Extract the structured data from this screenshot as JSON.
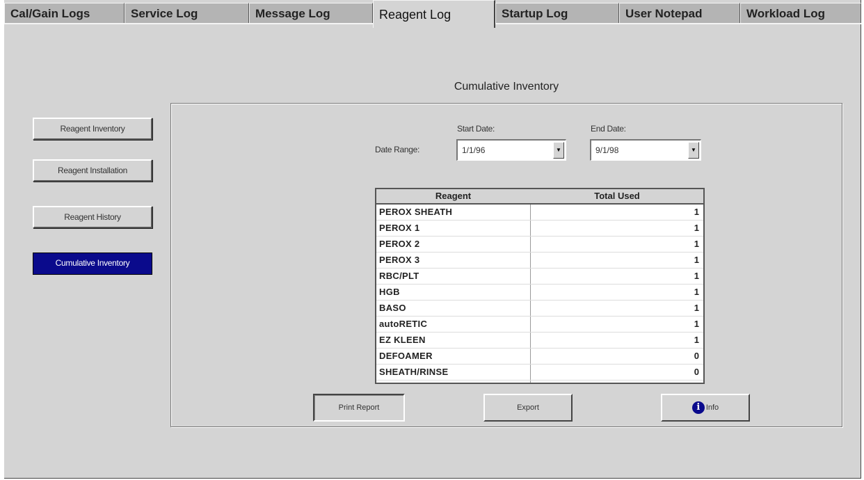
{
  "tabs": [
    {
      "label": "Cal/Gain Logs"
    },
    {
      "label": "Service Log"
    },
    {
      "label": "Message Log"
    },
    {
      "label": "Reagent Log",
      "active": true
    },
    {
      "label": "Startup Log"
    },
    {
      "label": "User Notepad"
    },
    {
      "label": "Workload Log"
    }
  ],
  "sidebar": {
    "items": [
      {
        "label": "Reagent Inventory"
      },
      {
        "label": "Reagent Installation"
      },
      {
        "label": "Reagent History"
      },
      {
        "label": "Cumulative Inventory",
        "active": true
      }
    ]
  },
  "main": {
    "title": "Cumulative Inventory",
    "date_range_label": "Date Range:",
    "start_date": {
      "label": "Start Date:",
      "value": "1/1/96"
    },
    "end_date": {
      "label": "End Date:",
      "value": "9/1/98"
    },
    "table": {
      "columns": [
        "Reagent",
        "Total Used"
      ],
      "rows": [
        {
          "reagent": "PEROX SHEATH",
          "total": "1"
        },
        {
          "reagent": "PEROX 1",
          "total": "1"
        },
        {
          "reagent": "PEROX 2",
          "total": "1"
        },
        {
          "reagent": "PEROX 3",
          "total": "1"
        },
        {
          "reagent": "RBC/PLT",
          "total": "1"
        },
        {
          "reagent": "HGB",
          "total": "1"
        },
        {
          "reagent": "BASO",
          "total": "1"
        },
        {
          "reagent": "autoRETIC",
          "total": "1"
        },
        {
          "reagent": "EZ KLEEN",
          "total": "1"
        },
        {
          "reagent": "DEFOAMER",
          "total": "0"
        },
        {
          "reagent": "SHEATH/RINSE",
          "total": "0"
        }
      ]
    },
    "buttons": {
      "print_report": "Print Report",
      "export": "Export",
      "info": "Info"
    }
  },
  "colors": {
    "window_bg": "#d4d4d4",
    "active_button_bg": "#0a0a8c",
    "tab_bg": "#b4b4b4"
  },
  "icons": {
    "info": "info-circle-icon",
    "dropdown": "chevron-down-icon"
  }
}
